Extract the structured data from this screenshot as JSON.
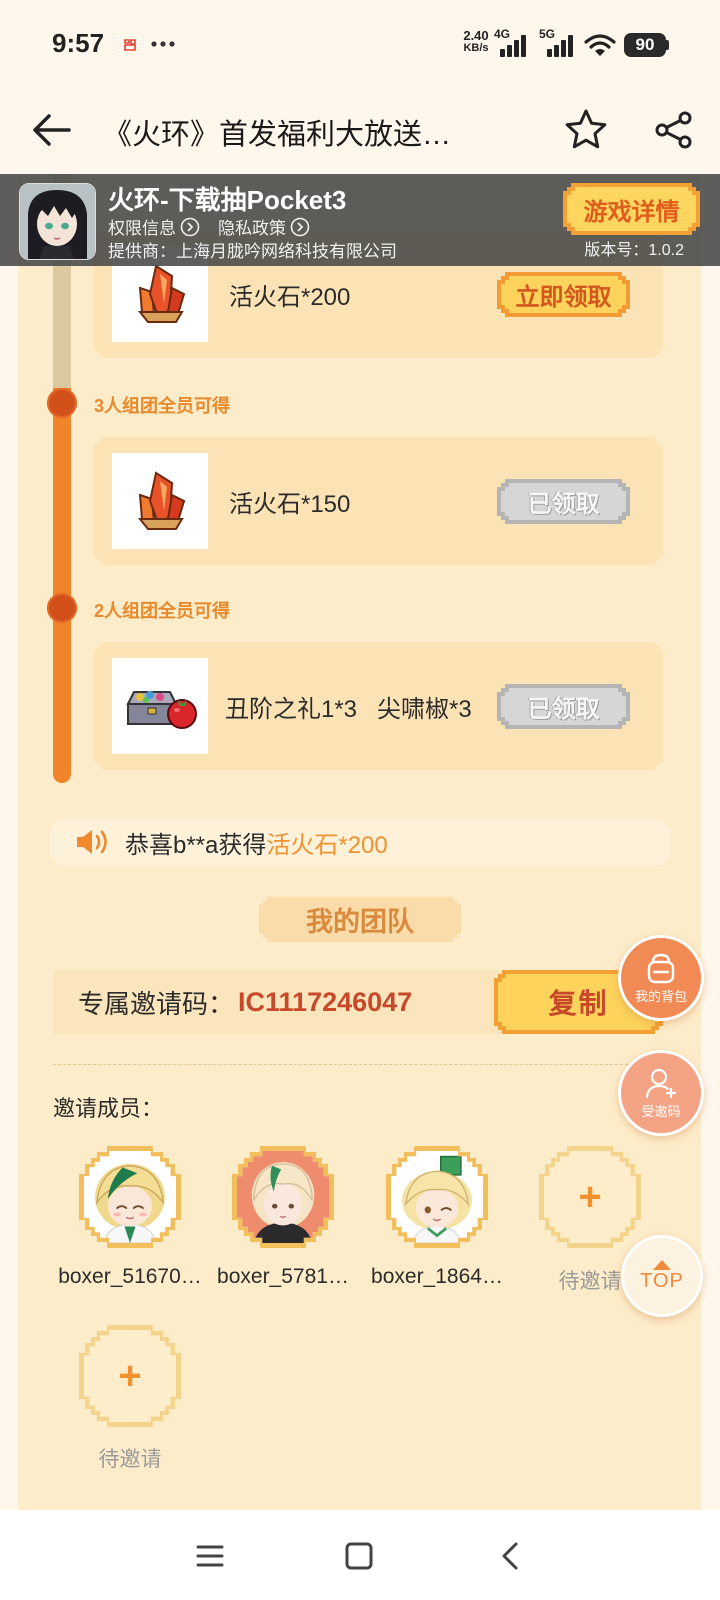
{
  "status_bar": {
    "time": "9:57",
    "net_speed": "2.40",
    "net_speed_unit": "KB/s",
    "network_primary": "4G",
    "network_secondary": "5G",
    "battery_level": "90",
    "icons": [
      "app-notification-icon",
      "more-dots-icon",
      "signal-icon",
      "signal-icon",
      "wifi-icon",
      "battery-icon"
    ]
  },
  "header": {
    "title": "《火环》首发福利大放送…",
    "icons": [
      "back-arrow-icon",
      "star-icon",
      "share-icon"
    ]
  },
  "game_banner": {
    "title": "火环-下载抽Pocket3",
    "permissions": "权限信息",
    "privacy": "隐私政策",
    "provider": "提供商：上海月胧吟网络科技有限公司",
    "details_button": "游戏详情",
    "version": "版本号：1.0.2",
    "icon": "game-app-icon"
  },
  "rewards": [
    {
      "items": "活火石*200",
      "button": "立即领取",
      "status": "claimable",
      "icon": "fire-crystal-icon"
    },
    {
      "tier": "3人组团全员可得",
      "items": "活火石*150",
      "button": "已领取",
      "status": "claimed",
      "icon": "fire-crystal-icon"
    },
    {
      "tier": "2人组团全员可得",
      "items": "丑阶之礼1*3   尖啸椒*3",
      "button": "已领取",
      "status": "claimed",
      "icon": "gift-chest-icon"
    }
  ],
  "announcement": {
    "prefix": "恭喜b**a获得",
    "highlight": "活火石*200",
    "icon": "speaker-icon"
  },
  "team": {
    "title": "我的团队",
    "invite_code_label": "专属邀请码：",
    "invite_code": "IC1117246047",
    "copy_button": "复制",
    "members_label": "邀请成员：",
    "members": [
      {
        "name": "boxer_51670…",
        "avatar": "member-avatar"
      },
      {
        "name": "boxer_5781…",
        "avatar": "member-avatar"
      },
      {
        "name": "boxer_1864…",
        "avatar": "member-avatar"
      }
    ],
    "empty_slots": [
      {
        "label": "待邀请",
        "icon": "plus-icon"
      },
      {
        "label": "待邀请",
        "icon": "plus-icon"
      }
    ]
  },
  "floating_actions": {
    "backpack": "我的背包",
    "invite_code": "受邀码",
    "top": "TOP"
  },
  "nav_bar": {
    "icons": [
      "menu-icon",
      "home-square-icon",
      "back-chevron-icon"
    ]
  },
  "colors": {
    "accent": "#f0842a",
    "claim_button_text": "#d4571e",
    "invite_code_text": "#c8482a",
    "tier_label": "#e8892c",
    "panel_background": "#fdecc9"
  }
}
